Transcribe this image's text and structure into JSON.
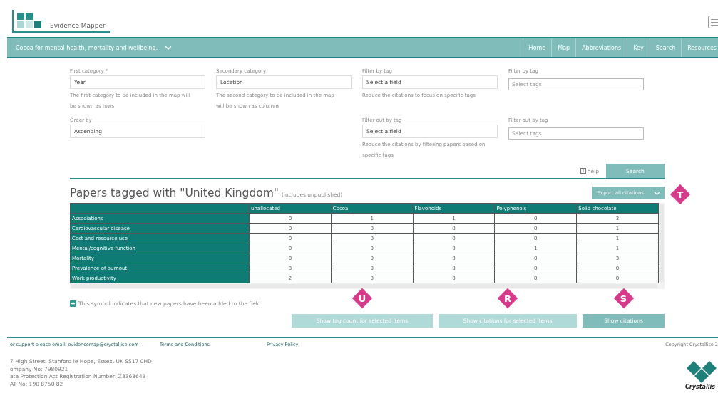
{
  "header": {
    "logo_text": "Evidence Mapper"
  },
  "navbar": {
    "title": "Cocoa for mental health, mortality and wellbeing.",
    "items": [
      {
        "label": "Home"
      },
      {
        "label": "Map"
      },
      {
        "label": "Abbreviations"
      },
      {
        "label": "Key"
      },
      {
        "label": "Search"
      },
      {
        "label": "Resources"
      }
    ]
  },
  "form": {
    "fields": [
      {
        "label": "First category *",
        "kind": "select",
        "value": "Year",
        "hint": "The first category to be included in the map will be shown as rows"
      },
      {
        "label": "Secondary category",
        "kind": "select",
        "value": "Location",
        "hint": "The second category to be included in the map will be shown as columns"
      },
      {
        "label": "Filter by tag",
        "kind": "select",
        "value": "Select a field",
        "hint": "Reduce the citations to focus on specific tags"
      },
      {
        "label": "Filter by tag",
        "kind": "tags",
        "placeholder": "Select tags"
      },
      {
        "label": "Order by",
        "kind": "select",
        "value": "Ascending"
      },
      {
        "kind": "empty"
      },
      {
        "label": "Filter out by tag",
        "kind": "select",
        "value": "Select a field",
        "hint": "Reduce the citations by filtering papers based on specific tags"
      },
      {
        "label": "Filter out by tag",
        "kind": "tags",
        "placeholder": "Select tags"
      }
    ],
    "help": "help",
    "search_button": "Search"
  },
  "results": {
    "title": "Papers tagged with \"United Kingdom\"",
    "subtitle": "(includes unpublished)",
    "export_button": "Export all citations",
    "export_marker": "T",
    "table": {
      "columns": [
        "unallocated",
        "Cocoa",
        "Flavonoids",
        "Polyphenols",
        "Solid chocolate"
      ],
      "rows": [
        {
          "label": "Associations",
          "cells": [
            "0",
            "1",
            "1",
            "0",
            "3"
          ]
        },
        {
          "label": "Cardiovascular disease",
          "cells": [
            "0",
            "0",
            "0",
            "0",
            "1"
          ]
        },
        {
          "label": "Cost and resource use",
          "cells": [
            "0",
            "0",
            "0",
            "0",
            "1"
          ]
        },
        {
          "label": "Mental/cognitive function",
          "cells": [
            "0",
            "0",
            "0",
            "1",
            "1"
          ]
        },
        {
          "label": "Mortality",
          "cells": [
            "0",
            "0",
            "0",
            "0",
            "3"
          ]
        },
        {
          "label": "Prevalence of burnout",
          "cells": [
            "3",
            "0",
            "0",
            "0",
            "0"
          ]
        },
        {
          "label": "Work productivity",
          "cells": [
            "2",
            "0",
            "0",
            "0",
            "0"
          ]
        }
      ]
    },
    "note": "This symbol indicates that new papers have been added to the field",
    "buttons": [
      {
        "label": "Show tag count for selected items",
        "disabled": true,
        "marker": "U"
      },
      {
        "label": "Show citations for selected items",
        "disabled": true,
        "marker": "R"
      },
      {
        "label": "Show citations",
        "disabled": false,
        "marker": "S"
      }
    ]
  },
  "footer": {
    "support": "or support please email: evidencemap@crystallise.com",
    "links": [
      "Terms and Conditions",
      "Privacy Policy"
    ],
    "copyright": "Copyright Crystallise 2",
    "address": [
      "7 High Street, Stanford le Hope, Essex, UK SS17 0HD",
      "ompany No: 7980921",
      "ata Protection Act Registration Number: Z3363643",
      "AT No: 190 8750 82"
    ],
    "logo_text": "Crystallis"
  }
}
